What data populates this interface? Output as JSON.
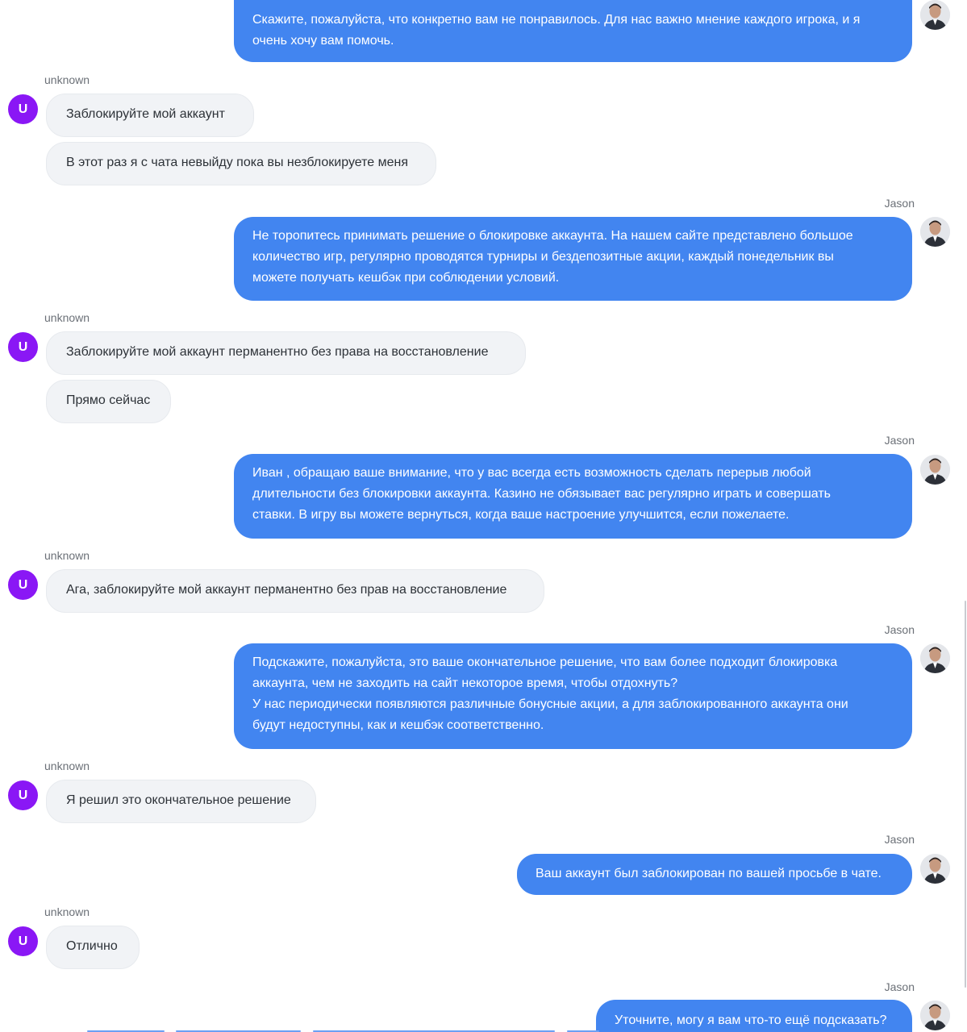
{
  "agent_name": "Jason",
  "user_name": "unknown",
  "user_avatar_letter": "U",
  "colors": {
    "agent_bubble": "#4285f0",
    "user_bubble": "#f1f3f6",
    "user_avatar": "#8a17f5"
  },
  "messages": [
    {
      "sender": "agent",
      "text": "Скажите, пожалуйста, что конкретно вам не понравилось. Для нас важно мнение каждого игрока, и я\nочень хочу вам помочь."
    },
    {
      "sender": "user",
      "text": "Заблокируйте мой аккаунт"
    },
    {
      "sender": "user",
      "text": "В этот раз я с чата невыйду пока вы незблокируете меня"
    },
    {
      "sender": "agent",
      "text": "Не торопитесь принимать решение о блокировке аккаунта. На нашем сайте представлено большое\nколичество игр, регулярно проводятся турниры и бездепозитные акции, каждый понедельник вы\nможете получать кешбэк при соблюдении условий."
    },
    {
      "sender": "user",
      "text": "Заблокируйте мой аккаунт перманентно без права на восстановление"
    },
    {
      "sender": "user",
      "text": "Прямо сейчас"
    },
    {
      "sender": "agent",
      "text": "Иван , обращаю ваше внимание, что у вас всегда есть возможность сделать перерыв любой\nдлительности без блокировки аккаунта. Казино не обязывает вас регулярно играть и совершать\nставки. В игру вы можете вернуться, когда ваше настроение улучшится, если пожелаете."
    },
    {
      "sender": "user",
      "text": "Ага, заблокируйте мой аккаунт перманентно без прав на восстановление"
    },
    {
      "sender": "agent",
      "text": "Подскажите, пожалуйста, это ваше окончательное решение, что вам более подходит блокировка\nаккаунта, чем не заходить на сайт некоторое время, чтобы отдохнуть?\nУ нас периодически появляются различные бонусные акции, а для заблокированного аккаунта они\nбудут недоступны, как и кешбэк соответственно."
    },
    {
      "sender": "user",
      "text": "Я решил это окончательное решение"
    },
    {
      "sender": "agent",
      "text": "Ваш аккаунт был заблокирован по вашей просьбе в чате."
    },
    {
      "sender": "user",
      "text": "Отлично"
    },
    {
      "sender": "agent",
      "text": "Уточните, могу я вам что-то ещё подсказать?"
    }
  ]
}
